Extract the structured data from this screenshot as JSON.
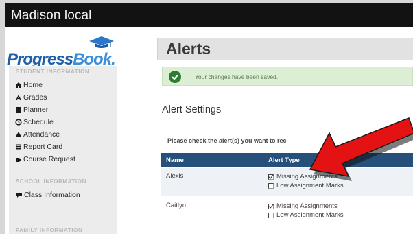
{
  "app": {
    "title": "Madison local"
  },
  "logo": {
    "word_part1": "Progress",
    "word_part2": "Book",
    "trademark": "."
  },
  "sidebar": {
    "student_section": "STUDENT INFORMATION",
    "items": [
      {
        "label": "Home",
        "icon": "home-icon"
      },
      {
        "label": "Grades",
        "icon": "grades-icon"
      },
      {
        "label": "Planner",
        "icon": "planner-icon"
      },
      {
        "label": "Schedule",
        "icon": "schedule-icon"
      },
      {
        "label": "Attendance",
        "icon": "attendance-icon"
      },
      {
        "label": "Report Card",
        "icon": "report-card-icon"
      },
      {
        "label": "Course Request",
        "icon": "course-request-icon"
      }
    ],
    "school_section": "SCHOOL INFORMATION",
    "school_items": [
      {
        "label": "Class Information",
        "icon": "class-info-icon"
      }
    ],
    "family_section": "FAMILY INFORMATION"
  },
  "main": {
    "page_title": "Alerts",
    "success_message": "Your changes have been saved.",
    "settings_title": "Alert Settings",
    "instructions": "Please check the alert(s) you want to rec",
    "table": {
      "headers": [
        "Name",
        "Alert Type"
      ],
      "rows": [
        {
          "name": "Alexis",
          "options": [
            {
              "label": "Missing Assignments",
              "checked": true
            },
            {
              "label": "Low Assignment Marks",
              "checked": false
            }
          ]
        },
        {
          "name": "Caitlyn",
          "options": [
            {
              "label": "Missing Assignments",
              "checked": true
            },
            {
              "label": "Low Assignment Marks",
              "checked": false
            }
          ]
        }
      ]
    }
  },
  "colors": {
    "topbar": "#121212",
    "table_header": "#264f7a",
    "success_bg": "#dcefd5",
    "success_icon": "#2f7d32",
    "arrow": "#e41212"
  }
}
